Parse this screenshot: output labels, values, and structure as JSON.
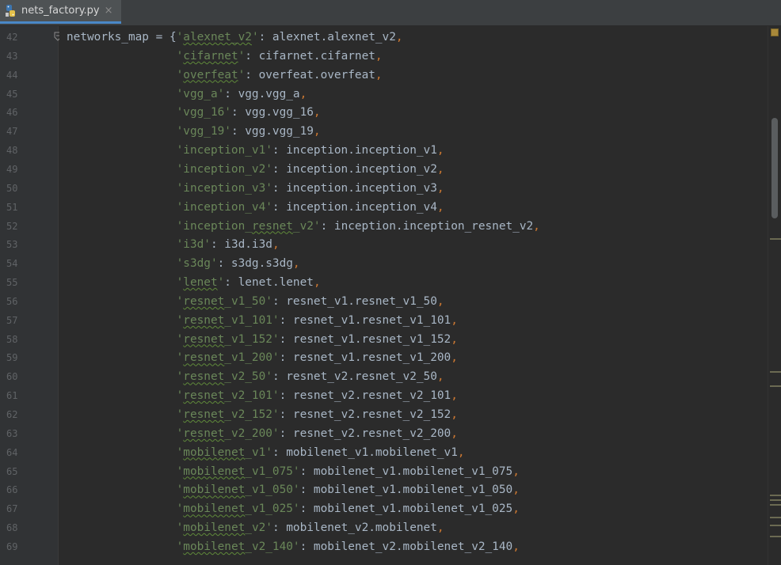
{
  "tab": {
    "filename": "nets_factory.py",
    "close": "×"
  },
  "lines": [
    {
      "num": "42",
      "parts": [
        [
          "",
          "networks_map = {"
        ],
        [
          "s",
          "'"
        ],
        [
          "su",
          "alexnet_v2"
        ],
        [
          "s",
          "'"
        ],
        [
          "",
          ": alexnet.alexnet_v2"
        ],
        [
          "p",
          ","
        ]
      ]
    },
    {
      "num": "43",
      "parts": [
        [
          "",
          "                "
        ],
        [
          "s",
          "'"
        ],
        [
          "su",
          "cifarnet"
        ],
        [
          "s",
          "'"
        ],
        [
          "",
          ": cifarnet.cifarnet"
        ],
        [
          "p",
          ","
        ]
      ]
    },
    {
      "num": "44",
      "parts": [
        [
          "",
          "                "
        ],
        [
          "s",
          "'"
        ],
        [
          "su",
          "overfeat"
        ],
        [
          "s",
          "'"
        ],
        [
          "",
          ": overfeat.overfeat"
        ],
        [
          "p",
          ","
        ]
      ]
    },
    {
      "num": "45",
      "parts": [
        [
          "",
          "                "
        ],
        [
          "s",
          "'vgg_a'"
        ],
        [
          "",
          ": vgg.vgg_a"
        ],
        [
          "p",
          ","
        ]
      ]
    },
    {
      "num": "46",
      "parts": [
        [
          "",
          "                "
        ],
        [
          "s",
          "'vgg_16'"
        ],
        [
          "",
          ": vgg.vgg_16"
        ],
        [
          "p",
          ","
        ]
      ]
    },
    {
      "num": "47",
      "parts": [
        [
          "",
          "                "
        ],
        [
          "s",
          "'vgg_19'"
        ],
        [
          "",
          ": vgg.vgg_19"
        ],
        [
          "p",
          ","
        ]
      ]
    },
    {
      "num": "48",
      "parts": [
        [
          "",
          "                "
        ],
        [
          "s",
          "'inception_v1'"
        ],
        [
          "",
          ": inception.inception_v1"
        ],
        [
          "p",
          ","
        ]
      ]
    },
    {
      "num": "49",
      "parts": [
        [
          "",
          "                "
        ],
        [
          "s",
          "'inception_v2'"
        ],
        [
          "",
          ": inception.inception_v2"
        ],
        [
          "p",
          ","
        ]
      ]
    },
    {
      "num": "50",
      "parts": [
        [
          "",
          "                "
        ],
        [
          "s",
          "'inception_v3'"
        ],
        [
          "",
          ": inception.inception_v3"
        ],
        [
          "p",
          ","
        ]
      ]
    },
    {
      "num": "51",
      "parts": [
        [
          "",
          "                "
        ],
        [
          "s",
          "'inception_v4'"
        ],
        [
          "",
          ": inception.inception_v4"
        ],
        [
          "p",
          ","
        ]
      ]
    },
    {
      "num": "52",
      "parts": [
        [
          "",
          "                "
        ],
        [
          "s",
          "'inception_"
        ],
        [
          "su",
          "resnet"
        ],
        [
          "s",
          "_v2'"
        ],
        [
          "",
          ": inception.inception_resnet_v2"
        ],
        [
          "p",
          ","
        ]
      ]
    },
    {
      "num": "53",
      "parts": [
        [
          "",
          "                "
        ],
        [
          "s",
          "'i3d'"
        ],
        [
          "",
          ": i3d.i3d"
        ],
        [
          "p",
          ","
        ]
      ]
    },
    {
      "num": "54",
      "parts": [
        [
          "",
          "                "
        ],
        [
          "s",
          "'s3dg'"
        ],
        [
          "",
          ": s3dg.s3dg"
        ],
        [
          "p",
          ","
        ]
      ]
    },
    {
      "num": "55",
      "parts": [
        [
          "",
          "                "
        ],
        [
          "s",
          "'"
        ],
        [
          "su",
          "lenet"
        ],
        [
          "s",
          "'"
        ],
        [
          "",
          ": lenet.lenet"
        ],
        [
          "p",
          ","
        ]
      ]
    },
    {
      "num": "56",
      "parts": [
        [
          "",
          "                "
        ],
        [
          "s",
          "'"
        ],
        [
          "su",
          "resnet"
        ],
        [
          "s",
          "_v1_50'"
        ],
        [
          "",
          ": resnet_v1.resnet_v1_50"
        ],
        [
          "p",
          ","
        ]
      ]
    },
    {
      "num": "57",
      "parts": [
        [
          "",
          "                "
        ],
        [
          "s",
          "'"
        ],
        [
          "su",
          "resnet"
        ],
        [
          "s",
          "_v1_101'"
        ],
        [
          "",
          ": resnet_v1.resnet_v1_101"
        ],
        [
          "p",
          ","
        ]
      ]
    },
    {
      "num": "58",
      "parts": [
        [
          "",
          "                "
        ],
        [
          "s",
          "'"
        ],
        [
          "su",
          "resnet"
        ],
        [
          "s",
          "_v1_152'"
        ],
        [
          "",
          ": resnet_v1.resnet_v1_152"
        ],
        [
          "p",
          ","
        ]
      ]
    },
    {
      "num": "59",
      "parts": [
        [
          "",
          "                "
        ],
        [
          "s",
          "'"
        ],
        [
          "su",
          "resnet"
        ],
        [
          "s",
          "_v1_200'"
        ],
        [
          "",
          ": resnet_v1.resnet_v1_200"
        ],
        [
          "p",
          ","
        ]
      ]
    },
    {
      "num": "60",
      "parts": [
        [
          "",
          "                "
        ],
        [
          "s",
          "'"
        ],
        [
          "su",
          "resnet"
        ],
        [
          "s",
          "_v2_50'"
        ],
        [
          "",
          ": resnet_v2.resnet_v2_50"
        ],
        [
          "p",
          ","
        ]
      ]
    },
    {
      "num": "61",
      "parts": [
        [
          "",
          "                "
        ],
        [
          "s",
          "'"
        ],
        [
          "su",
          "resnet"
        ],
        [
          "s",
          "_v2_101'"
        ],
        [
          "",
          ": resnet_v2.resnet_v2_101"
        ],
        [
          "p",
          ","
        ]
      ]
    },
    {
      "num": "62",
      "parts": [
        [
          "",
          "                "
        ],
        [
          "s",
          "'"
        ],
        [
          "su",
          "resnet"
        ],
        [
          "s",
          "_v2_152'"
        ],
        [
          "",
          ": resnet_v2.resnet_v2_152"
        ],
        [
          "p",
          ","
        ]
      ]
    },
    {
      "num": "63",
      "parts": [
        [
          "",
          "                "
        ],
        [
          "s",
          "'"
        ],
        [
          "su",
          "resnet"
        ],
        [
          "s",
          "_v2_200'"
        ],
        [
          "",
          ": resnet_v2.resnet_v2_200"
        ],
        [
          "p",
          ","
        ]
      ]
    },
    {
      "num": "64",
      "parts": [
        [
          "",
          "                "
        ],
        [
          "s",
          "'"
        ],
        [
          "su",
          "mobilenet"
        ],
        [
          "s",
          "_v1'"
        ],
        [
          "",
          ": mobilenet_v1.mobilenet_v1"
        ],
        [
          "p",
          ","
        ]
      ]
    },
    {
      "num": "65",
      "parts": [
        [
          "",
          "                "
        ],
        [
          "s",
          "'"
        ],
        [
          "su",
          "mobilenet"
        ],
        [
          "s",
          "_v1_075'"
        ],
        [
          "",
          ": mobilenet_v1.mobilenet_v1_075"
        ],
        [
          "p",
          ","
        ]
      ]
    },
    {
      "num": "66",
      "parts": [
        [
          "",
          "                "
        ],
        [
          "s",
          "'"
        ],
        [
          "su",
          "mobilenet"
        ],
        [
          "s",
          "_v1_050'"
        ],
        [
          "",
          ": mobilenet_v1.mobilenet_v1_050"
        ],
        [
          "p",
          ","
        ]
      ]
    },
    {
      "num": "67",
      "parts": [
        [
          "",
          "                "
        ],
        [
          "s",
          "'"
        ],
        [
          "su",
          "mobilenet"
        ],
        [
          "s",
          "_v1_025'"
        ],
        [
          "",
          ": mobilenet_v1.mobilenet_v1_025"
        ],
        [
          "p",
          ","
        ]
      ]
    },
    {
      "num": "68",
      "parts": [
        [
          "",
          "                "
        ],
        [
          "s",
          "'"
        ],
        [
          "su",
          "mobilenet"
        ],
        [
          "s",
          "_v2'"
        ],
        [
          "",
          ": mobilenet_v2.mobilenet"
        ],
        [
          "p",
          ","
        ]
      ]
    },
    {
      "num": "69",
      "parts": [
        [
          "",
          "                "
        ],
        [
          "s",
          "'"
        ],
        [
          "su",
          "mobilenet"
        ],
        [
          "s",
          "_v2_140'"
        ],
        [
          "",
          ": mobilenet_v2.mobilenet_v2_140"
        ],
        [
          "p",
          ","
        ]
      ]
    }
  ],
  "colors": {
    "string": "#6a8759",
    "keyword": "#cc7832",
    "text": "#a9b7c6",
    "tab_accent": "#4a88c7"
  }
}
